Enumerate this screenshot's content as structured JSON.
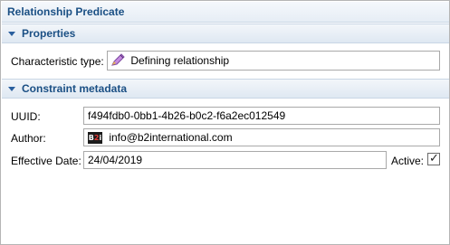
{
  "window": {
    "title": "Relationship Predicate"
  },
  "properties": {
    "header": "Properties",
    "characteristic_type_label": "Characteristic type:",
    "characteristic_type_value": "Defining relationship"
  },
  "constraint_metadata": {
    "header": "Constraint metadata",
    "uuid_label": "UUID:",
    "uuid_value": "f494fdb0-0bb1-4b26-b0c2-f6a2ec012549",
    "author_label": "Author:",
    "author_value": "info@b2international.com",
    "effective_date_label": "Effective Date:",
    "effective_date_value": "24/04/2019",
    "active_label": "Active:",
    "active_checked": true
  },
  "icons": {
    "characteristic_type": "pencil-icon",
    "author": "b2i-logo-icon",
    "twisty": "chevron-down-icon"
  },
  "colors": {
    "header_text": "#1a4f84",
    "accent": "#2a5f9e"
  }
}
